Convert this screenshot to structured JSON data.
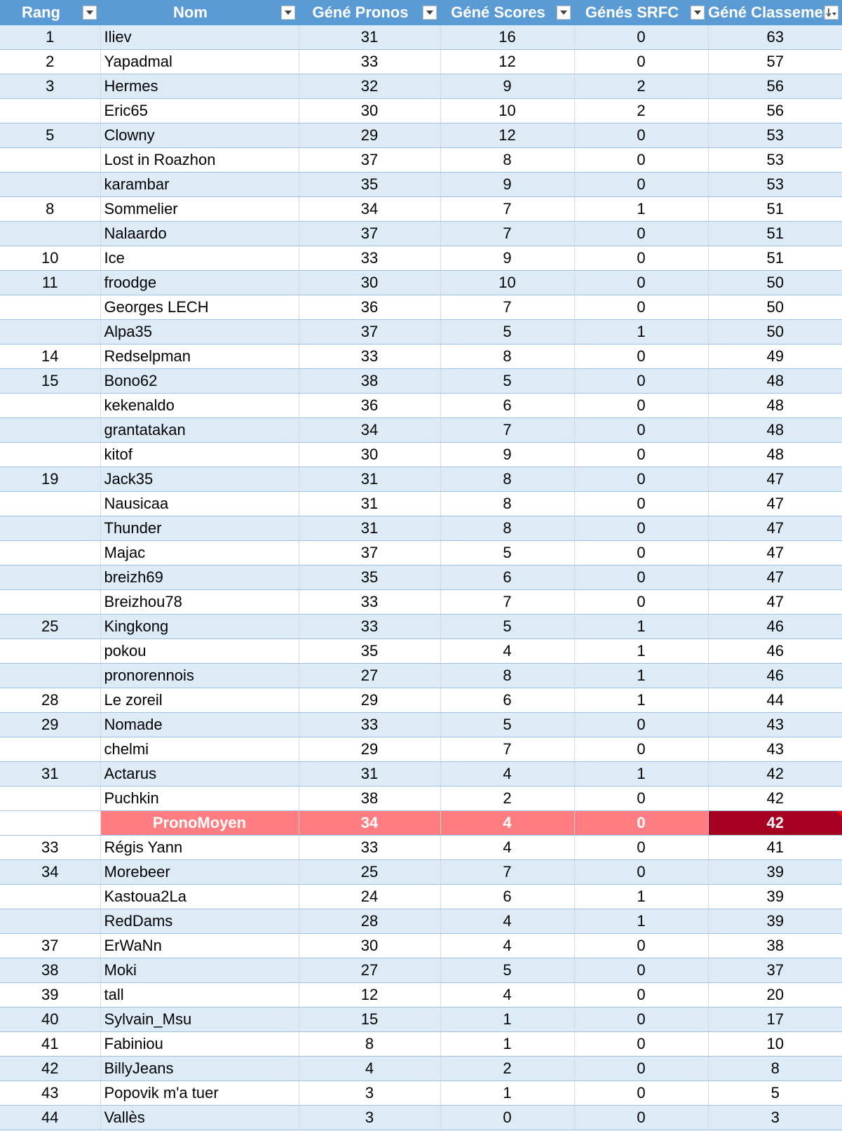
{
  "columns": [
    {
      "label": "Rang"
    },
    {
      "label": "Nom"
    },
    {
      "label": "Géné Pronos"
    },
    {
      "label": "Géné Scores"
    },
    {
      "label": "Génés SRFC"
    },
    {
      "label": "Géné Classement",
      "sort": "descending"
    }
  ],
  "colors": {
    "header": "#5b9bd5",
    "band": "#ddebf7",
    "highlight_row": "#ff7c80",
    "highlight_total": "#a50021"
  },
  "rows": [
    {
      "rang": "1",
      "nom": "Iliev",
      "pronos": "31",
      "scores": "16",
      "srfc": "0",
      "classement": "63"
    },
    {
      "rang": "2",
      "nom": "Yapadmal",
      "pronos": "33",
      "scores": "12",
      "srfc": "0",
      "classement": "57"
    },
    {
      "rang": "3",
      "nom": "Hermes",
      "pronos": "32",
      "scores": "9",
      "srfc": "2",
      "classement": "56"
    },
    {
      "rang": "",
      "nom": "Eric65",
      "pronos": "30",
      "scores": "10",
      "srfc": "2",
      "classement": "56"
    },
    {
      "rang": "5",
      "nom": "Clowny",
      "pronos": "29",
      "scores": "12",
      "srfc": "0",
      "classement": "53"
    },
    {
      "rang": "",
      "nom": "Lost in Roazhon",
      "pronos": "37",
      "scores": "8",
      "srfc": "0",
      "classement": "53"
    },
    {
      "rang": "",
      "nom": "karambar",
      "pronos": "35",
      "scores": "9",
      "srfc": "0",
      "classement": "53"
    },
    {
      "rang": "8",
      "nom": "Sommelier",
      "pronos": "34",
      "scores": "7",
      "srfc": "1",
      "classement": "51"
    },
    {
      "rang": "",
      "nom": "Nalaardo",
      "pronos": "37",
      "scores": "7",
      "srfc": "0",
      "classement": "51"
    },
    {
      "rang": "10",
      "nom": "Ice",
      "pronos": "33",
      "scores": "9",
      "srfc": "0",
      "classement": "51"
    },
    {
      "rang": "11",
      "nom": "froodge",
      "pronos": "30",
      "scores": "10",
      "srfc": "0",
      "classement": "50"
    },
    {
      "rang": "",
      "nom": "Georges LECH",
      "pronos": "36",
      "scores": "7",
      "srfc": "0",
      "classement": "50"
    },
    {
      "rang": "",
      "nom": "Alpa35",
      "pronos": "37",
      "scores": "5",
      "srfc": "1",
      "classement": "50"
    },
    {
      "rang": "14",
      "nom": "Redselpman",
      "pronos": "33",
      "scores": "8",
      "srfc": "0",
      "classement": "49"
    },
    {
      "rang": "15",
      "nom": "Bono62",
      "pronos": "38",
      "scores": "5",
      "srfc": "0",
      "classement": "48"
    },
    {
      "rang": "",
      "nom": "kekenaldo",
      "pronos": "36",
      "scores": "6",
      "srfc": "0",
      "classement": "48"
    },
    {
      "rang": "",
      "nom": "grantatakan",
      "pronos": "34",
      "scores": "7",
      "srfc": "0",
      "classement": "48"
    },
    {
      "rang": "",
      "nom": "kitof",
      "pronos": "30",
      "scores": "9",
      "srfc": "0",
      "classement": "48"
    },
    {
      "rang": "19",
      "nom": "Jack35",
      "pronos": "31",
      "scores": "8",
      "srfc": "0",
      "classement": "47"
    },
    {
      "rang": "",
      "nom": "Nausicaa",
      "pronos": "31",
      "scores": "8",
      "srfc": "0",
      "classement": "47"
    },
    {
      "rang": "",
      "nom": "Thunder",
      "pronos": "31",
      "scores": "8",
      "srfc": "0",
      "classement": "47"
    },
    {
      "rang": "",
      "nom": "Majac",
      "pronos": "37",
      "scores": "5",
      "srfc": "0",
      "classement": "47"
    },
    {
      "rang": "",
      "nom": "breizh69",
      "pronos": "35",
      "scores": "6",
      "srfc": "0",
      "classement": "47"
    },
    {
      "rang": "",
      "nom": "Breizhou78",
      "pronos": "33",
      "scores": "7",
      "srfc": "0",
      "classement": "47"
    },
    {
      "rang": "25",
      "nom": "Kingkong",
      "pronos": "33",
      "scores": "5",
      "srfc": "1",
      "classement": "46"
    },
    {
      "rang": "",
      "nom": "pokou",
      "pronos": "35",
      "scores": "4",
      "srfc": "1",
      "classement": "46"
    },
    {
      "rang": "",
      "nom": "pronorennois",
      "pronos": "27",
      "scores": "8",
      "srfc": "1",
      "classement": "46"
    },
    {
      "rang": "28",
      "nom": "Le zoreil",
      "pronos": "29",
      "scores": "6",
      "srfc": "1",
      "classement": "44"
    },
    {
      "rang": "29",
      "nom": "Nomade",
      "pronos": "33",
      "scores": "5",
      "srfc": "0",
      "classement": "43"
    },
    {
      "rang": "",
      "nom": "chelmi",
      "pronos": "29",
      "scores": "7",
      "srfc": "0",
      "classement": "43"
    },
    {
      "rang": "31",
      "nom": "Actarus",
      "pronos": "31",
      "scores": "4",
      "srfc": "1",
      "classement": "42"
    },
    {
      "rang": "",
      "nom": "Puchkin",
      "pronos": "38",
      "scores": "2",
      "srfc": "0",
      "classement": "42"
    },
    {
      "rang": "",
      "nom": "PronoMoyen",
      "pronos": "34",
      "scores": "4",
      "srfc": "0",
      "classement": "42",
      "highlight": true
    },
    {
      "rang": "33",
      "nom": "Régis Yann",
      "pronos": "33",
      "scores": "4",
      "srfc": "0",
      "classement": "41"
    },
    {
      "rang": "34",
      "nom": "Morebeer",
      "pronos": "25",
      "scores": "7",
      "srfc": "0",
      "classement": "39"
    },
    {
      "rang": "",
      "nom": "Kastoua2La",
      "pronos": "24",
      "scores": "6",
      "srfc": "1",
      "classement": "39"
    },
    {
      "rang": "",
      "nom": "RedDams",
      "pronos": "28",
      "scores": "4",
      "srfc": "1",
      "classement": "39"
    },
    {
      "rang": "37",
      "nom": "ErWaNn",
      "pronos": "30",
      "scores": "4",
      "srfc": "0",
      "classement": "38"
    },
    {
      "rang": "38",
      "nom": "Moki",
      "pronos": "27",
      "scores": "5",
      "srfc": "0",
      "classement": "37"
    },
    {
      "rang": "39",
      "nom": "tall",
      "pronos": "12",
      "scores": "4",
      "srfc": "0",
      "classement": "20"
    },
    {
      "rang": "40",
      "nom": "Sylvain_Msu",
      "pronos": "15",
      "scores": "1",
      "srfc": "0",
      "classement": "17"
    },
    {
      "rang": "41",
      "nom": "Fabiniou",
      "pronos": "8",
      "scores": "1",
      "srfc": "0",
      "classement": "10"
    },
    {
      "rang": "42",
      "nom": "BillyJeans",
      "pronos": "4",
      "scores": "2",
      "srfc": "0",
      "classement": "8"
    },
    {
      "rang": "43",
      "nom": "Popovik m'a tuer",
      "pronos": "3",
      "scores": "1",
      "srfc": "0",
      "classement": "5"
    },
    {
      "rang": "44",
      "nom": "Vallès",
      "pronos": "3",
      "scores": "0",
      "srfc": "0",
      "classement": "3"
    }
  ]
}
